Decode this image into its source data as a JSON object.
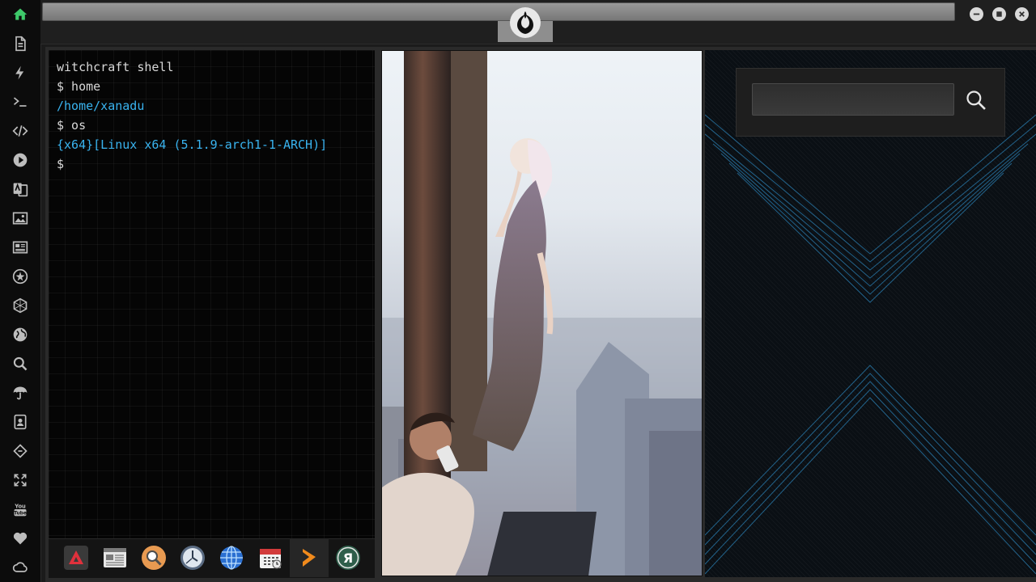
{
  "sidebar": {
    "items": [
      {
        "icon": "home-icon",
        "active": true
      },
      {
        "icon": "document-icon"
      },
      {
        "icon": "lightning-icon"
      },
      {
        "icon": "terminal-icon"
      },
      {
        "icon": "code-icon"
      },
      {
        "icon": "play-icon"
      },
      {
        "icon": "translate-icon"
      },
      {
        "icon": "image-icon"
      },
      {
        "icon": "newspaper-icon"
      },
      {
        "icon": "rebel-alliance-icon"
      },
      {
        "icon": "hexagon-network-icon"
      },
      {
        "icon": "globe-icon"
      },
      {
        "icon": "search-icon"
      },
      {
        "icon": "umbrella-icon"
      },
      {
        "icon": "contacts-icon"
      },
      {
        "icon": "diamond-code-icon"
      },
      {
        "icon": "expand-icon"
      },
      {
        "icon": "youtube-icon"
      },
      {
        "icon": "heart-icon"
      },
      {
        "icon": "cloud-icon"
      }
    ],
    "active_color": "#3ec96a"
  },
  "window": {
    "logo_icon": "rebel-alliance-icon",
    "controls": [
      "minimize-icon",
      "maximize-icon",
      "close-icon"
    ]
  },
  "terminal": {
    "lines": [
      {
        "text": "witchcraft shell",
        "kind": "cmd"
      },
      {
        "text": "$ home",
        "kind": "cmd"
      },
      {
        "text": "/home/xanadu",
        "kind": "out"
      },
      {
        "text": "$ os",
        "kind": "cmd"
      },
      {
        "text": "{x64}[Linux x64 (5.1.9-arch1-1-ARCH)]",
        "kind": "out"
      },
      {
        "text": "$",
        "kind": "cmd"
      }
    ],
    "output_color": "#39b3ef"
  },
  "dock": {
    "apps": [
      {
        "icon": "arch-app-icon"
      },
      {
        "icon": "news-app-icon"
      },
      {
        "icon": "search-app-icon"
      },
      {
        "icon": "clock-app-icon"
      },
      {
        "icon": "browser-globe-icon"
      },
      {
        "icon": "calendar-app-icon"
      },
      {
        "icon": "sublime-text-icon",
        "highlighted": true
      },
      {
        "icon": "yandex-icon"
      }
    ]
  },
  "search": {
    "value": "",
    "button_icon": "search-icon"
  }
}
